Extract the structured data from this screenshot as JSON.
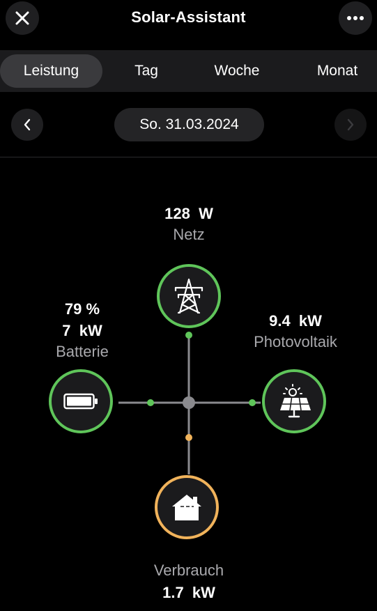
{
  "header": {
    "title": "Solar-Assistant",
    "close_icon": "close-icon",
    "more_icon": "more-horizontal-icon"
  },
  "tabs": [
    {
      "label": "Leistung",
      "active": true
    },
    {
      "label": "Tag",
      "active": false
    },
    {
      "label": "Woche",
      "active": false
    },
    {
      "label": "Monat",
      "active": false
    }
  ],
  "date_nav": {
    "date": "So. 31.03.2024",
    "prev_icon": "chevron-left-icon",
    "next_icon": "chevron-right-icon",
    "next_enabled": false
  },
  "flow": {
    "grid": {
      "value": "128  W",
      "label": "Netz",
      "icon": "power-tower-icon"
    },
    "battery": {
      "percent": "79 %",
      "value": "7  kW",
      "label": "Batterie",
      "icon": "battery-icon"
    },
    "pv": {
      "value": "9.4  kW",
      "label": "Photovoltaik",
      "icon": "solar-panel-icon"
    },
    "consumption": {
      "value": "1.7  kW",
      "label": "Verbrauch",
      "icon": "house-icon"
    }
  },
  "colors": {
    "green": "#5fc55a",
    "orange": "#f1b35b",
    "line": "#8a8a8e",
    "background": "#000000"
  }
}
